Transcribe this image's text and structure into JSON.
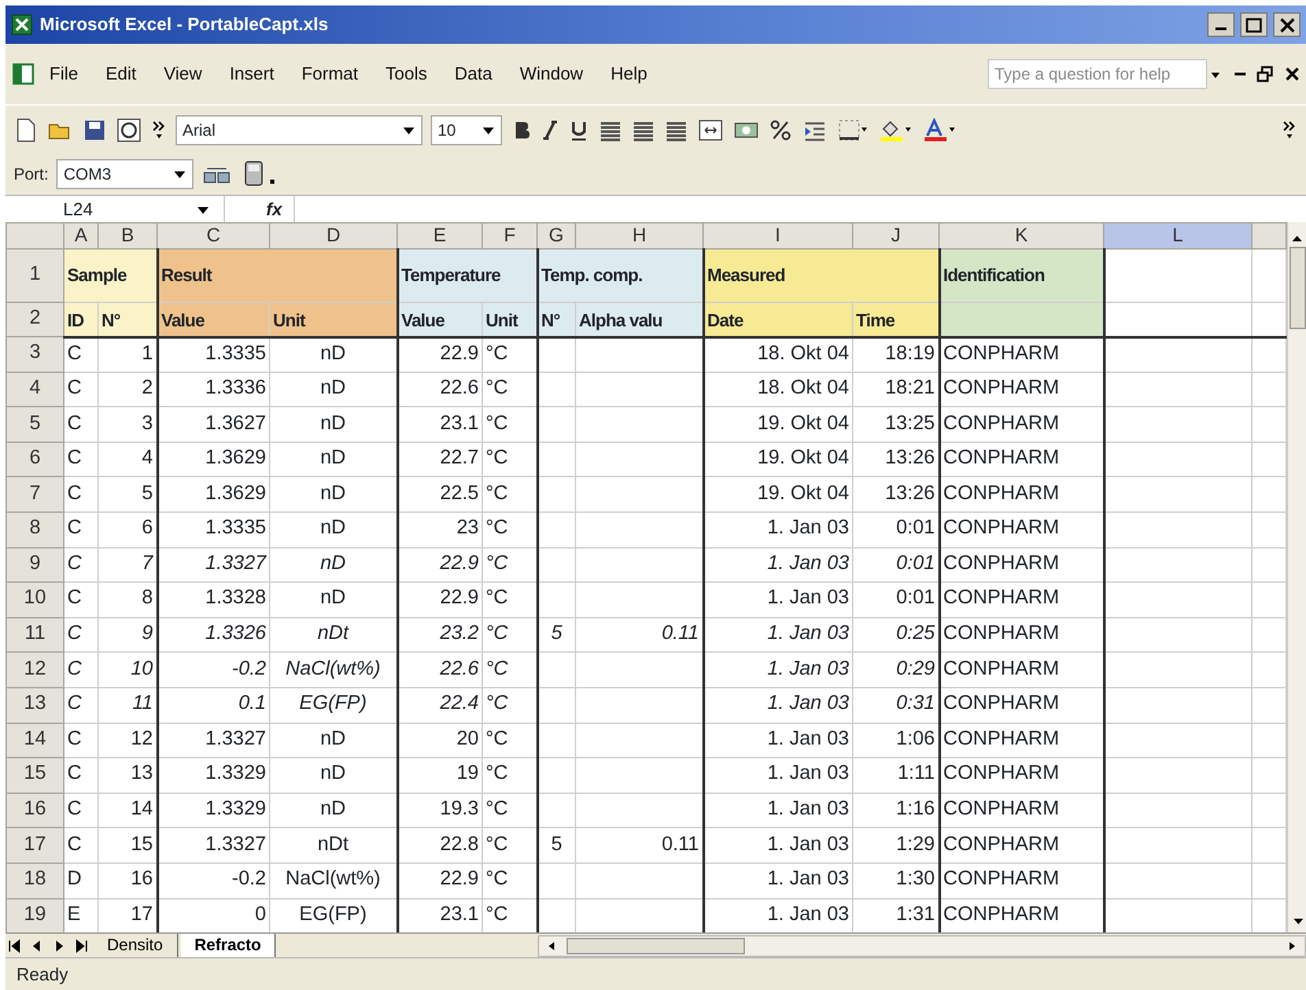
{
  "window": {
    "title": "Microsoft Excel - PortableCapt.xls"
  },
  "menu": {
    "items": [
      "File",
      "Edit",
      "View",
      "Insert",
      "Format",
      "Tools",
      "Data",
      "Window",
      "Help"
    ],
    "help_box": {
      "placeholder": "Type a question for help"
    }
  },
  "toolbar": {
    "font": "Arial",
    "size": "10"
  },
  "port_toolbar": {
    "label": "Port:",
    "value": "COM3"
  },
  "formula_bar": {
    "name_box": "L24",
    "fx": "fx"
  },
  "column_headers": [
    {
      "label": "A",
      "selected": false
    },
    {
      "label": "B",
      "selected": false
    },
    {
      "label": "C",
      "selected": false
    },
    {
      "label": "D",
      "selected": false
    },
    {
      "label": "E",
      "selected": false
    },
    {
      "label": "F",
      "selected": false
    },
    {
      "label": "G",
      "selected": false
    },
    {
      "label": "H",
      "selected": false
    },
    {
      "label": "I",
      "selected": false
    },
    {
      "label": "J",
      "selected": false
    },
    {
      "label": "K",
      "selected": false
    },
    {
      "label": "L",
      "selected": true
    }
  ],
  "group_header": {
    "row": "1",
    "groups": [
      {
        "label": "Sample",
        "color": "#fbf3c8"
      },
      {
        "label": "Result",
        "color": "#efc28c"
      },
      {
        "label": "Temperature",
        "color": "#dcebf0"
      },
      {
        "label": "Temp. comp.",
        "color": "#dcebf0"
      },
      {
        "label": "Measured",
        "color": "#f6ea95"
      },
      {
        "label": "Identification",
        "color": "#d5e6c6"
      }
    ]
  },
  "sub_header": {
    "row": "2",
    "labels": [
      "ID",
      "N°",
      "Value",
      "Unit",
      "Value",
      "Unit",
      "N°",
      "Alpha valu",
      "Date",
      "Time"
    ]
  },
  "rows": [
    {
      "row": "3",
      "italic": false,
      "id": "C",
      "n": "1",
      "value": "1.3335",
      "unit": "nD",
      "temp": "22.9",
      "temp_unit": "°C",
      "date": "18. Okt 04",
      "time": "18:19",
      "identification": "CONPHARM"
    },
    {
      "row": "4",
      "italic": false,
      "id": "C",
      "n": "2",
      "value": "1.3336",
      "unit": "nD",
      "temp": "22.6",
      "temp_unit": "°C",
      "date": "18. Okt 04",
      "time": "18:21",
      "identification": "CONPHARM"
    },
    {
      "row": "5",
      "italic": false,
      "id": "C",
      "n": "3",
      "value": "1.3627",
      "unit": "nD",
      "temp": "23.1",
      "temp_unit": "°C",
      "date": "19. Okt 04",
      "time": "13:25",
      "identification": "CONPHARM"
    },
    {
      "row": "6",
      "italic": false,
      "id": "C",
      "n": "4",
      "value": "1.3629",
      "unit": "nD",
      "temp": "22.7",
      "temp_unit": "°C",
      "date": "19. Okt 04",
      "time": "13:26",
      "identification": "CONPHARM"
    },
    {
      "row": "7",
      "italic": false,
      "id": "C",
      "n": "5",
      "value": "1.3629",
      "unit": "nD",
      "temp": "22.5",
      "temp_unit": "°C",
      "date": "19. Okt 04",
      "time": "13:26",
      "identification": "CONPHARM"
    },
    {
      "row": "8",
      "italic": false,
      "id": "C",
      "n": "6",
      "value": "1.3335",
      "unit": "nD",
      "temp": "23",
      "temp_unit": "°C",
      "date": "1. Jan 03",
      "time": "0:01",
      "identification": "CONPHARM"
    },
    {
      "row": "9",
      "italic": true,
      "id": "C",
      "n": "7",
      "value": "1.3327",
      "unit": "nD",
      "temp": "22.9",
      "temp_unit": "°C",
      "date": "1. Jan 03",
      "time": "0:01",
      "identification": "CONPHARM"
    },
    {
      "row": "10",
      "italic": false,
      "id": "C",
      "n": "8",
      "value": "1.3328",
      "unit": "nD",
      "temp": "22.9",
      "temp_unit": "°C",
      "date": "1. Jan 03",
      "time": "0:01",
      "identification": "CONPHARM"
    },
    {
      "row": "11",
      "italic": true,
      "id": "C",
      "n": "9",
      "value": "1.3326",
      "unit": "nDt",
      "temp": "23.2",
      "temp_unit": "°C",
      "comp_n": "5",
      "alpha": "0.11",
      "date": "1. Jan 03",
      "time": "0:25",
      "identification": "CONPHARM"
    },
    {
      "row": "12",
      "italic": true,
      "id": "C",
      "n": "10",
      "value": "-0.2",
      "unit": "NaCl(wt%)",
      "temp": "22.6",
      "temp_unit": "°C",
      "date": "1. Jan 03",
      "time": "0:29",
      "identification": "CONPHARM"
    },
    {
      "row": "13",
      "italic": true,
      "id": "C",
      "n": "11",
      "value": "0.1",
      "unit": "EG(FP)",
      "temp": "22.4",
      "temp_unit": "°C",
      "date": "1. Jan 03",
      "time": "0:31",
      "identification": "CONPHARM"
    },
    {
      "row": "14",
      "italic": false,
      "id": "C",
      "n": "12",
      "value": "1.3327",
      "unit": "nD",
      "temp": "20",
      "temp_unit": "°C",
      "date": "1. Jan 03",
      "time": "1:06",
      "identification": "CONPHARM"
    },
    {
      "row": "15",
      "italic": false,
      "id": "C",
      "n": "13",
      "value": "1.3329",
      "unit": "nD",
      "temp": "19",
      "temp_unit": "°C",
      "date": "1. Jan 03",
      "time": "1:11",
      "identification": "CONPHARM"
    },
    {
      "row": "16",
      "italic": false,
      "id": "C",
      "n": "14",
      "value": "1.3329",
      "unit": "nD",
      "temp": "19.3",
      "temp_unit": "°C",
      "date": "1. Jan 03",
      "time": "1:16",
      "identification": "CONPHARM"
    },
    {
      "row": "17",
      "italic": false,
      "id": "C",
      "n": "15",
      "value": "1.3327",
      "unit": "nDt",
      "temp": "22.8",
      "temp_unit": "°C",
      "comp_n": "5",
      "alpha": "0.11",
      "date": "1. Jan 03",
      "time": "1:29",
      "identification": "CONPHARM"
    },
    {
      "row": "18",
      "italic": false,
      "id": "D",
      "n": "16",
      "value": "-0.2",
      "unit": "NaCl(wt%)",
      "temp": "22.9",
      "temp_unit": "°C",
      "date": "1. Jan 03",
      "time": "1:30",
      "identification": "CONPHARM"
    },
    {
      "row": "19",
      "italic": false,
      "id": "E",
      "n": "17",
      "value": "0",
      "unit": "EG(FP)",
      "temp": "23.1",
      "temp_unit": "°C",
      "date": "1. Jan 03",
      "time": "1:31",
      "identification": "CONPHARM"
    }
  ],
  "sheet_tabs": [
    {
      "label": "Densito",
      "selected": false
    },
    {
      "label": "Refracto",
      "selected": true
    }
  ],
  "status_bar": {
    "text": "Ready"
  }
}
